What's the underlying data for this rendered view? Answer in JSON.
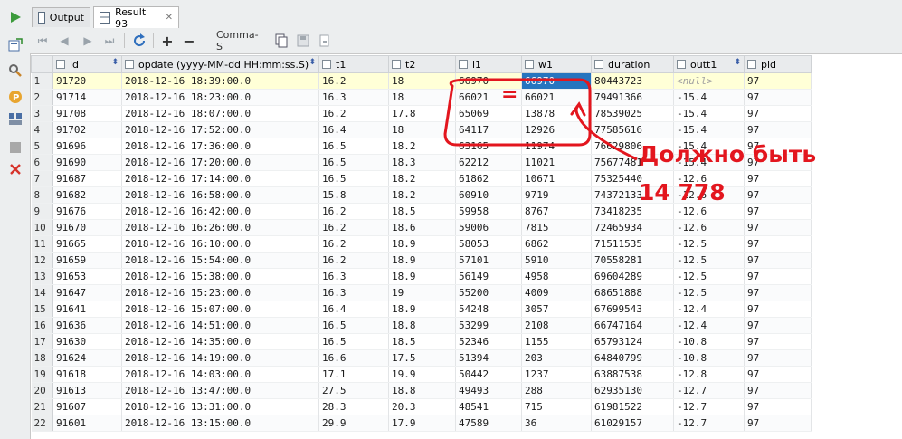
{
  "tabs": [
    {
      "label": "Output"
    },
    {
      "label": "Result 93"
    }
  ],
  "toolbar": {
    "format_label": "Comma-S"
  },
  "grid": {
    "columns": [
      "id",
      "opdate (yyyy-MM-dd HH:mm:ss.S)",
      "t1",
      "t2",
      "l1",
      "w1",
      "duration",
      "outt1",
      "pid"
    ],
    "rows": [
      [
        "1",
        "91720",
        "2018-12-16 18:39:00.0",
        "16.2",
        "18",
        "66970",
        "66970",
        "80443723",
        "<null>",
        "97"
      ],
      [
        "2",
        "91714",
        "2018-12-16 18:23:00.0",
        "16.3",
        "18",
        "66021",
        "66021",
        "79491366",
        "-15.4",
        "97"
      ],
      [
        "3",
        "91708",
        "2018-12-16 18:07:00.0",
        "16.2",
        "17.8",
        "65069",
        "13878",
        "78539025",
        "-15.4",
        "97"
      ],
      [
        "4",
        "91702",
        "2018-12-16 17:52:00.0",
        "16.4",
        "18",
        "64117",
        "12926",
        "77585616",
        "-15.4",
        "97"
      ],
      [
        "5",
        "91696",
        "2018-12-16 17:36:00.0",
        "16.5",
        "18.2",
        "63165",
        "11974",
        "76629806",
        "-15.4",
        "97"
      ],
      [
        "6",
        "91690",
        "2018-12-16 17:20:00.0",
        "16.5",
        "18.3",
        "62212",
        "11021",
        "75677481",
        "-15.4",
        "97"
      ],
      [
        "7",
        "91687",
        "2018-12-16 17:14:00.0",
        "16.5",
        "18.2",
        "61862",
        "10671",
        "75325440",
        "-12.6",
        "97"
      ],
      [
        "8",
        "91682",
        "2018-12-16 16:58:00.0",
        "15.8",
        "18.2",
        "60910",
        "9719",
        "74372133",
        "-12.6",
        "97"
      ],
      [
        "9",
        "91676",
        "2018-12-16 16:42:00.0",
        "16.2",
        "18.5",
        "59958",
        "8767",
        "73418235",
        "-12.6",
        "97"
      ],
      [
        "10",
        "91670",
        "2018-12-16 16:26:00.0",
        "16.2",
        "18.6",
        "59006",
        "7815",
        "72465934",
        "-12.6",
        "97"
      ],
      [
        "11",
        "91665",
        "2018-12-16 16:10:00.0",
        "16.2",
        "18.9",
        "58053",
        "6862",
        "71511535",
        "-12.5",
        "97"
      ],
      [
        "12",
        "91659",
        "2018-12-16 15:54:00.0",
        "16.2",
        "18.9",
        "57101",
        "5910",
        "70558281",
        "-12.5",
        "97"
      ],
      [
        "13",
        "91653",
        "2018-12-16 15:38:00.0",
        "16.3",
        "18.9",
        "56149",
        "4958",
        "69604289",
        "-12.5",
        "97"
      ],
      [
        "14",
        "91647",
        "2018-12-16 15:23:00.0",
        "16.3",
        "19",
        "55200",
        "4009",
        "68651888",
        "-12.5",
        "97"
      ],
      [
        "15",
        "91641",
        "2018-12-16 15:07:00.0",
        "16.4",
        "18.9",
        "54248",
        "3057",
        "67699543",
        "-12.4",
        "97"
      ],
      [
        "16",
        "91636",
        "2018-12-16 14:51:00.0",
        "16.5",
        "18.8",
        "53299",
        "2108",
        "66747164",
        "-12.4",
        "97"
      ],
      [
        "17",
        "91630",
        "2018-12-16 14:35:00.0",
        "16.5",
        "18.5",
        "52346",
        "1155",
        "65793124",
        "-10.8",
        "97"
      ],
      [
        "18",
        "91624",
        "2018-12-16 14:19:00.0",
        "16.6",
        "17.5",
        "51394",
        "203",
        "64840799",
        "-10.8",
        "97"
      ],
      [
        "19",
        "91618",
        "2018-12-16 14:03:00.0",
        "17.1",
        "19.9",
        "50442",
        "1237",
        "63887538",
        "-12.8",
        "97"
      ],
      [
        "20",
        "91613",
        "2018-12-16 13:47:00.0",
        "27.5",
        "18.8",
        "49493",
        "288",
        "62935130",
        "-12.7",
        "97"
      ],
      [
        "21",
        "91607",
        "2018-12-16 13:31:00.0",
        "28.3",
        "20.3",
        "48541",
        "715",
        "61981522",
        "-12.7",
        "97"
      ],
      [
        "22",
        "91601",
        "2018-12-16 13:15:00.0",
        "29.9",
        "17.9",
        "47589",
        "36",
        "61029157",
        "-12.7",
        "97"
      ]
    ]
  },
  "annotation": {
    "equals_sign": "=",
    "line1": "Должно быть",
    "line2": "14 778",
    "color": "#e3161e"
  },
  "colors": {
    "selection": "#2675bf",
    "current_row": "#ffffd7"
  }
}
